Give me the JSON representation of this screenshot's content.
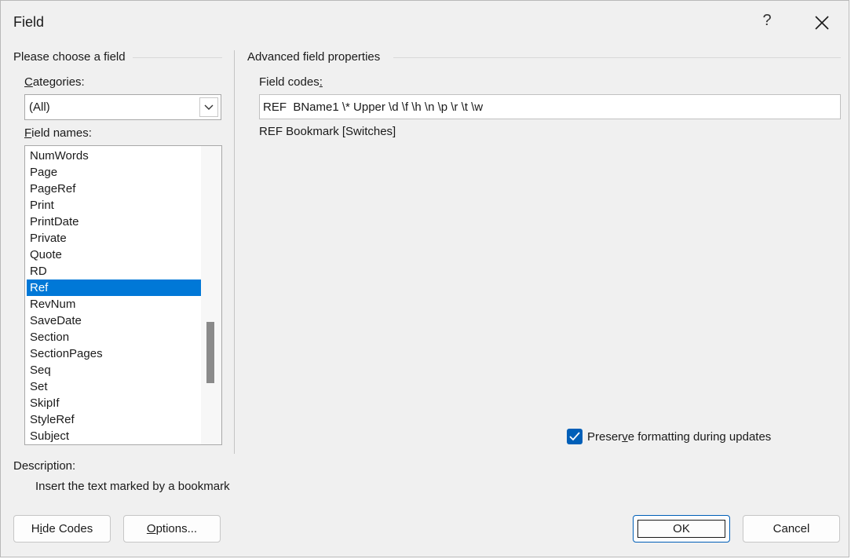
{
  "window": {
    "title": "Field",
    "help_label": "?"
  },
  "left_panel": {
    "group_label": "Please choose a field",
    "categories_label_accel": "C",
    "categories_label_rest": "ategories:",
    "categories_value": "(All)",
    "field_names_label_accel": "F",
    "field_names_label_rest": "ield names:",
    "field_names": [
      "NumWords",
      "Page",
      "PageRef",
      "Print",
      "PrintDate",
      "Private",
      "Quote",
      "RD",
      "Ref",
      "RevNum",
      "SaveDate",
      "Section",
      "SectionPages",
      "Seq",
      "Set",
      "SkipIf",
      "StyleRef",
      "Subject"
    ],
    "selected_field": "Ref",
    "description_label": "Description:",
    "description_text": "Insert the text marked by a bookmark"
  },
  "right_panel": {
    "group_label": "Advanced field properties",
    "field_codes_label_main": "Field codes",
    "field_codes_label_accel": ":",
    "field_codes_value": "REF  BName1 \\* Upper \\d \\f \\h \\n \\p \\r \\t \\w",
    "syntax_hint": "REF Bookmark [Switches]",
    "preserve_label_pre": "Preser",
    "preserve_label_accel": "v",
    "preserve_label_post": "e formatting during updates",
    "preserve_checked": true
  },
  "buttons": {
    "hide_codes_pre": "H",
    "hide_codes_accel": "i",
    "hide_codes_post": "de Codes",
    "options_accel": "O",
    "options_post": "ptions...",
    "ok": "OK",
    "cancel": "Cancel"
  },
  "colors": {
    "selection": "#0078d7",
    "checkbox": "#005fb8",
    "dialog_bg": "#f0f0f0"
  },
  "icons": {
    "close": "close-icon",
    "dropdown": "chevron-down-icon",
    "check": "checkmark-icon"
  }
}
